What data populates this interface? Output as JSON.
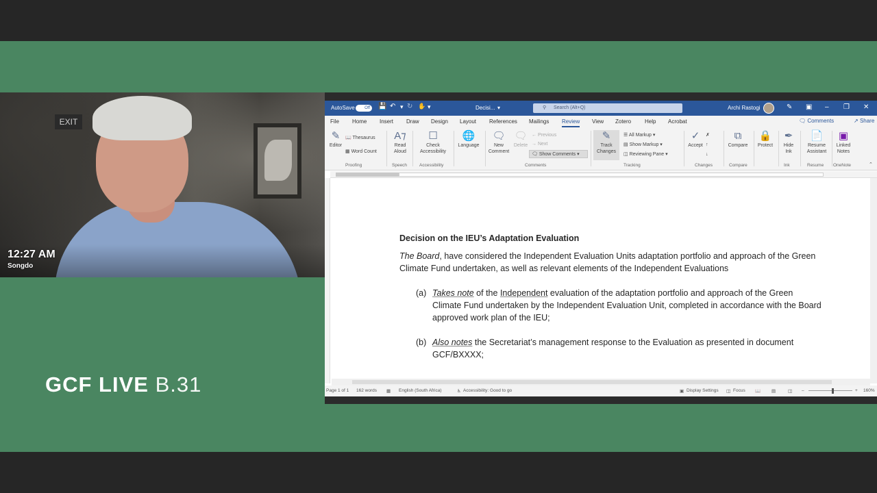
{
  "video": {
    "time": "12:27 AM",
    "location": "Songdo",
    "exit_sign": "EXIT"
  },
  "brand": {
    "part1": "GCF LIVE",
    "part2": "B.31"
  },
  "word": {
    "titlebar": {
      "autosave": "AutoSave",
      "toggle": "Off",
      "doc_name": "Decisi...",
      "search_placeholder": "Search (Alt+Q)",
      "user": "Archi Rastogi"
    },
    "tabs": [
      "File",
      "Home",
      "Insert",
      "Draw",
      "Design",
      "Layout",
      "References",
      "Mailings",
      "Review",
      "View",
      "Zotero",
      "Help",
      "Acrobat"
    ],
    "active_tab": "Review",
    "comments_label": "Comments",
    "share_label": "Share",
    "ribbon": {
      "editor": "Editor",
      "thesaurus": "Thesaurus",
      "word_count": "Word Count",
      "read_aloud_1": "Read",
      "read_aloud_2": "Aloud",
      "check_acc_1": "Check",
      "check_acc_2": "Accessibility",
      "language": "Language",
      "new_comment_1": "New",
      "new_comment_2": "Comment",
      "delete": "Delete",
      "previous": "Previous",
      "next": "Next",
      "show_comments": "Show Comments",
      "track_changes_1": "Track",
      "track_changes_2": "Changes",
      "all_markup": "All Markup",
      "show_markup": "Show Markup",
      "reviewing_pane": "Reviewing Pane",
      "accept": "Accept",
      "compare": "Compare",
      "protect": "Protect",
      "hide_ink_1": "Hide",
      "hide_ink_2": "Ink",
      "resume_1": "Resume",
      "resume_2": "Assistant",
      "linked_1": "Linked",
      "linked_2": "Notes",
      "groups": [
        "Proofing",
        "Speech",
        "Accessibility",
        "Comments",
        "Tracking",
        "Changes",
        "Compare",
        "Ink",
        "Resume",
        "OneNote"
      ]
    },
    "document": {
      "heading": "Decision on the IEU’s Adaptation Evaluation",
      "intro_italic": "The Board",
      "intro_rest": ", have considered the Independent Evaluation Units adaptation portfolio and approach of the Green Climate Fund undertaken, as well as relevant elements of the Independent Evaluations",
      "item_a_label": "(a)",
      "item_a_italic": "Takes note",
      "item_a_mid1": " of the ",
      "item_a_underlined": "Independent",
      "item_a_rest": " evaluation of the adaptation portfolio and approach of the Green Climate Fund undertaken by the Independent Evaluation Unit, completed in accordance with the Board approved work plan of the IEU;",
      "item_b_label": "(b)",
      "item_b_italic": " Also notes",
      "item_b_rest": " the Secretariat’s management response to the Evaluation as presented in document GCF/BXXXX;"
    },
    "status": {
      "page": "Page 1 of 1",
      "words": "162 words",
      "language": "English (South Africa)",
      "accessibility": "Accessibility: Good to go",
      "display_settings": "Display Settings",
      "focus": "Focus",
      "zoom": "160%"
    }
  }
}
